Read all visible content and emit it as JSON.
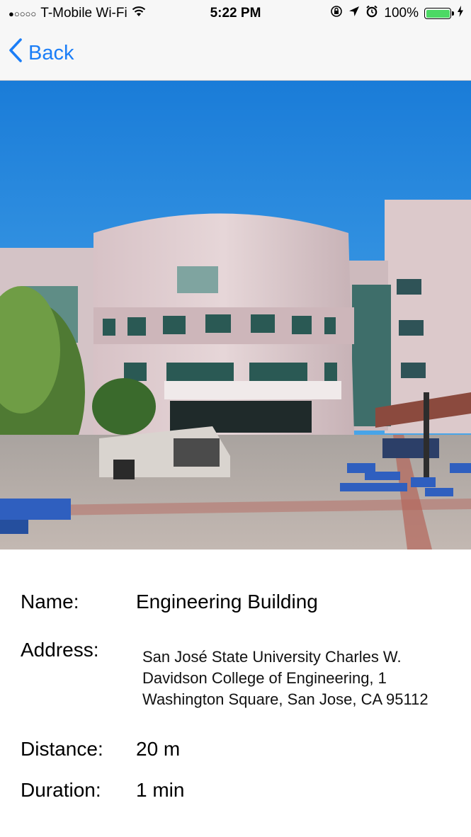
{
  "status_bar": {
    "signal": "●○○○○",
    "carrier": "T-Mobile Wi-Fi",
    "time": "5:22 PM",
    "battery_percent": "100%",
    "icons": [
      "wifi-icon",
      "rotation-lock-icon",
      "location-arrow-icon",
      "alarm-icon",
      "battery-icon",
      "charging-bolt-icon"
    ]
  },
  "nav": {
    "back_label": "Back"
  },
  "photo": {
    "subject": "building-photo"
  },
  "details": {
    "name_label": "Name:",
    "name_value": "Engineering Building",
    "address_label": "Address:",
    "address_value": "San José State University Charles W. Davidson College of Engineering, 1 Washington Square, San Jose, CA 95112",
    "distance_label": "Distance:",
    "distance_value": "20 m",
    "duration_label": "Duration:",
    "duration_value": "1 min"
  },
  "colors": {
    "accent": "#1b7ef7",
    "battery": "#4cd964",
    "bar_background": "#f7f7f7"
  }
}
